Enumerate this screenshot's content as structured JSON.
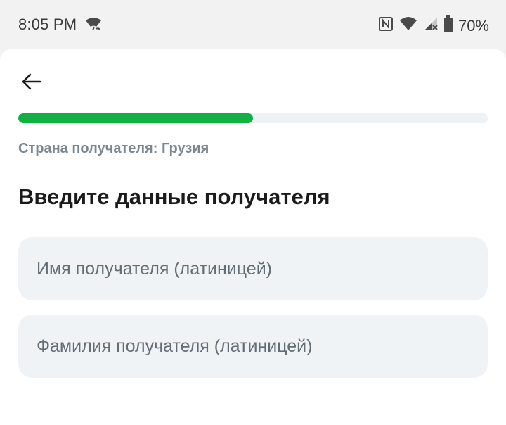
{
  "status_bar": {
    "time": "8:05 PM",
    "battery_percent": "70%",
    "icons_left": [
      "wifi-calling-icon"
    ],
    "icons_right": [
      "nfc-icon",
      "wifi-icon",
      "signal-no-service-icon",
      "battery-icon"
    ]
  },
  "header": {
    "back_icon": "arrow-left-icon"
  },
  "progress": {
    "fraction": 0.5
  },
  "recipient": {
    "country_line": "Страна получателя: Грузия",
    "title": "Введите данные получателя"
  },
  "form": {
    "first_name": {
      "value": "",
      "placeholder": "Имя получателя (латиницей)"
    },
    "last_name": {
      "value": "",
      "placeholder": "Фамилия получателя (латиницей)"
    }
  },
  "colors": {
    "accent": "#10b042",
    "field_bg": "#eff3f6",
    "muted_text": "#7c868f",
    "title_text": "#1b1b1b"
  }
}
